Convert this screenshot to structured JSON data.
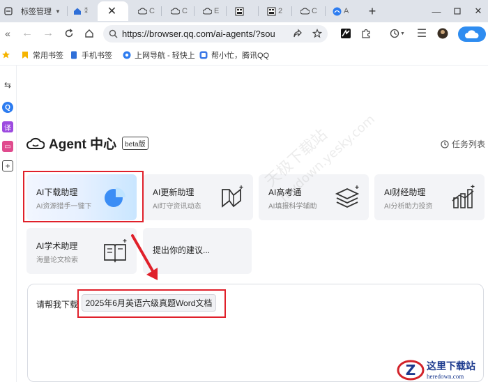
{
  "tabs": [
    {
      "label": "标签管理",
      "icon": "tab-manager-icon"
    },
    {
      "label": "",
      "icon": "home-icon"
    },
    {
      "label": "",
      "icon": "close-icon"
    },
    {
      "label": "C",
      "icon": "cloud-icon"
    },
    {
      "label": "C",
      "icon": "cloud-icon"
    },
    {
      "label": "E",
      "icon": "cloud-icon"
    },
    {
      "label": "",
      "icon": "site-icon"
    },
    {
      "label": "2",
      "icon": "site-icon"
    },
    {
      "label": "C",
      "icon": "cloud-icon"
    },
    {
      "label": "A",
      "icon": "browser-icon"
    }
  ],
  "nav": {
    "url": "https://browser.qq.com/ai-agents/?sou"
  },
  "bookmarks": [
    {
      "label": "常用书签",
      "icon": "bookmark-icon"
    },
    {
      "label": "手机书签",
      "icon": "phone-icon"
    },
    {
      "label": "上网导航 - 轻快上",
      "icon": "nav-icon"
    },
    {
      "label": "帮小忙，腾讯QQ",
      "icon": "helper-icon"
    }
  ],
  "sidebar": {
    "items": [
      {
        "name": "swap-icon",
        "glyph": "⇆"
      },
      {
        "name": "search-icon",
        "glyph": "Q"
      },
      {
        "name": "translate-icon",
        "glyph": "译"
      },
      {
        "name": "video-icon",
        "glyph": "▭"
      },
      {
        "name": "add-icon",
        "glyph": "+"
      }
    ]
  },
  "page": {
    "title": "Agent 中心",
    "badge": "beta版",
    "tasks_label": "任务列表"
  },
  "cards": [
    {
      "title": "AI下载助理",
      "subtitle": "AI资源猎手一键下",
      "icon": "pie-chart-icon"
    },
    {
      "title": "AI更新助理",
      "subtitle": "AI盯守资讯动态",
      "icon": "update-icon"
    },
    {
      "title": "AI高考通",
      "subtitle": "AI填报科学辅助",
      "icon": "layers-icon"
    },
    {
      "title": "AI财经助理",
      "subtitle": "AI分析助力投资",
      "icon": "finance-chart-icon"
    },
    {
      "title": "AI学术助理",
      "subtitle": "海量论文检索",
      "icon": "book-icon"
    }
  ],
  "suggest_label": "提出你的建议...",
  "input": {
    "prefix": "请帮我下载",
    "chip": "2025年6月英语六级真题Word文档"
  },
  "watermark": {
    "line1": "天极下载站",
    "line2": "mydown.yesky.com"
  },
  "logo": {
    "title": "这里下载站",
    "domain": "heredown.com"
  },
  "colors": {
    "highlight": "#e0202a",
    "accent": "#1e6ff5"
  }
}
